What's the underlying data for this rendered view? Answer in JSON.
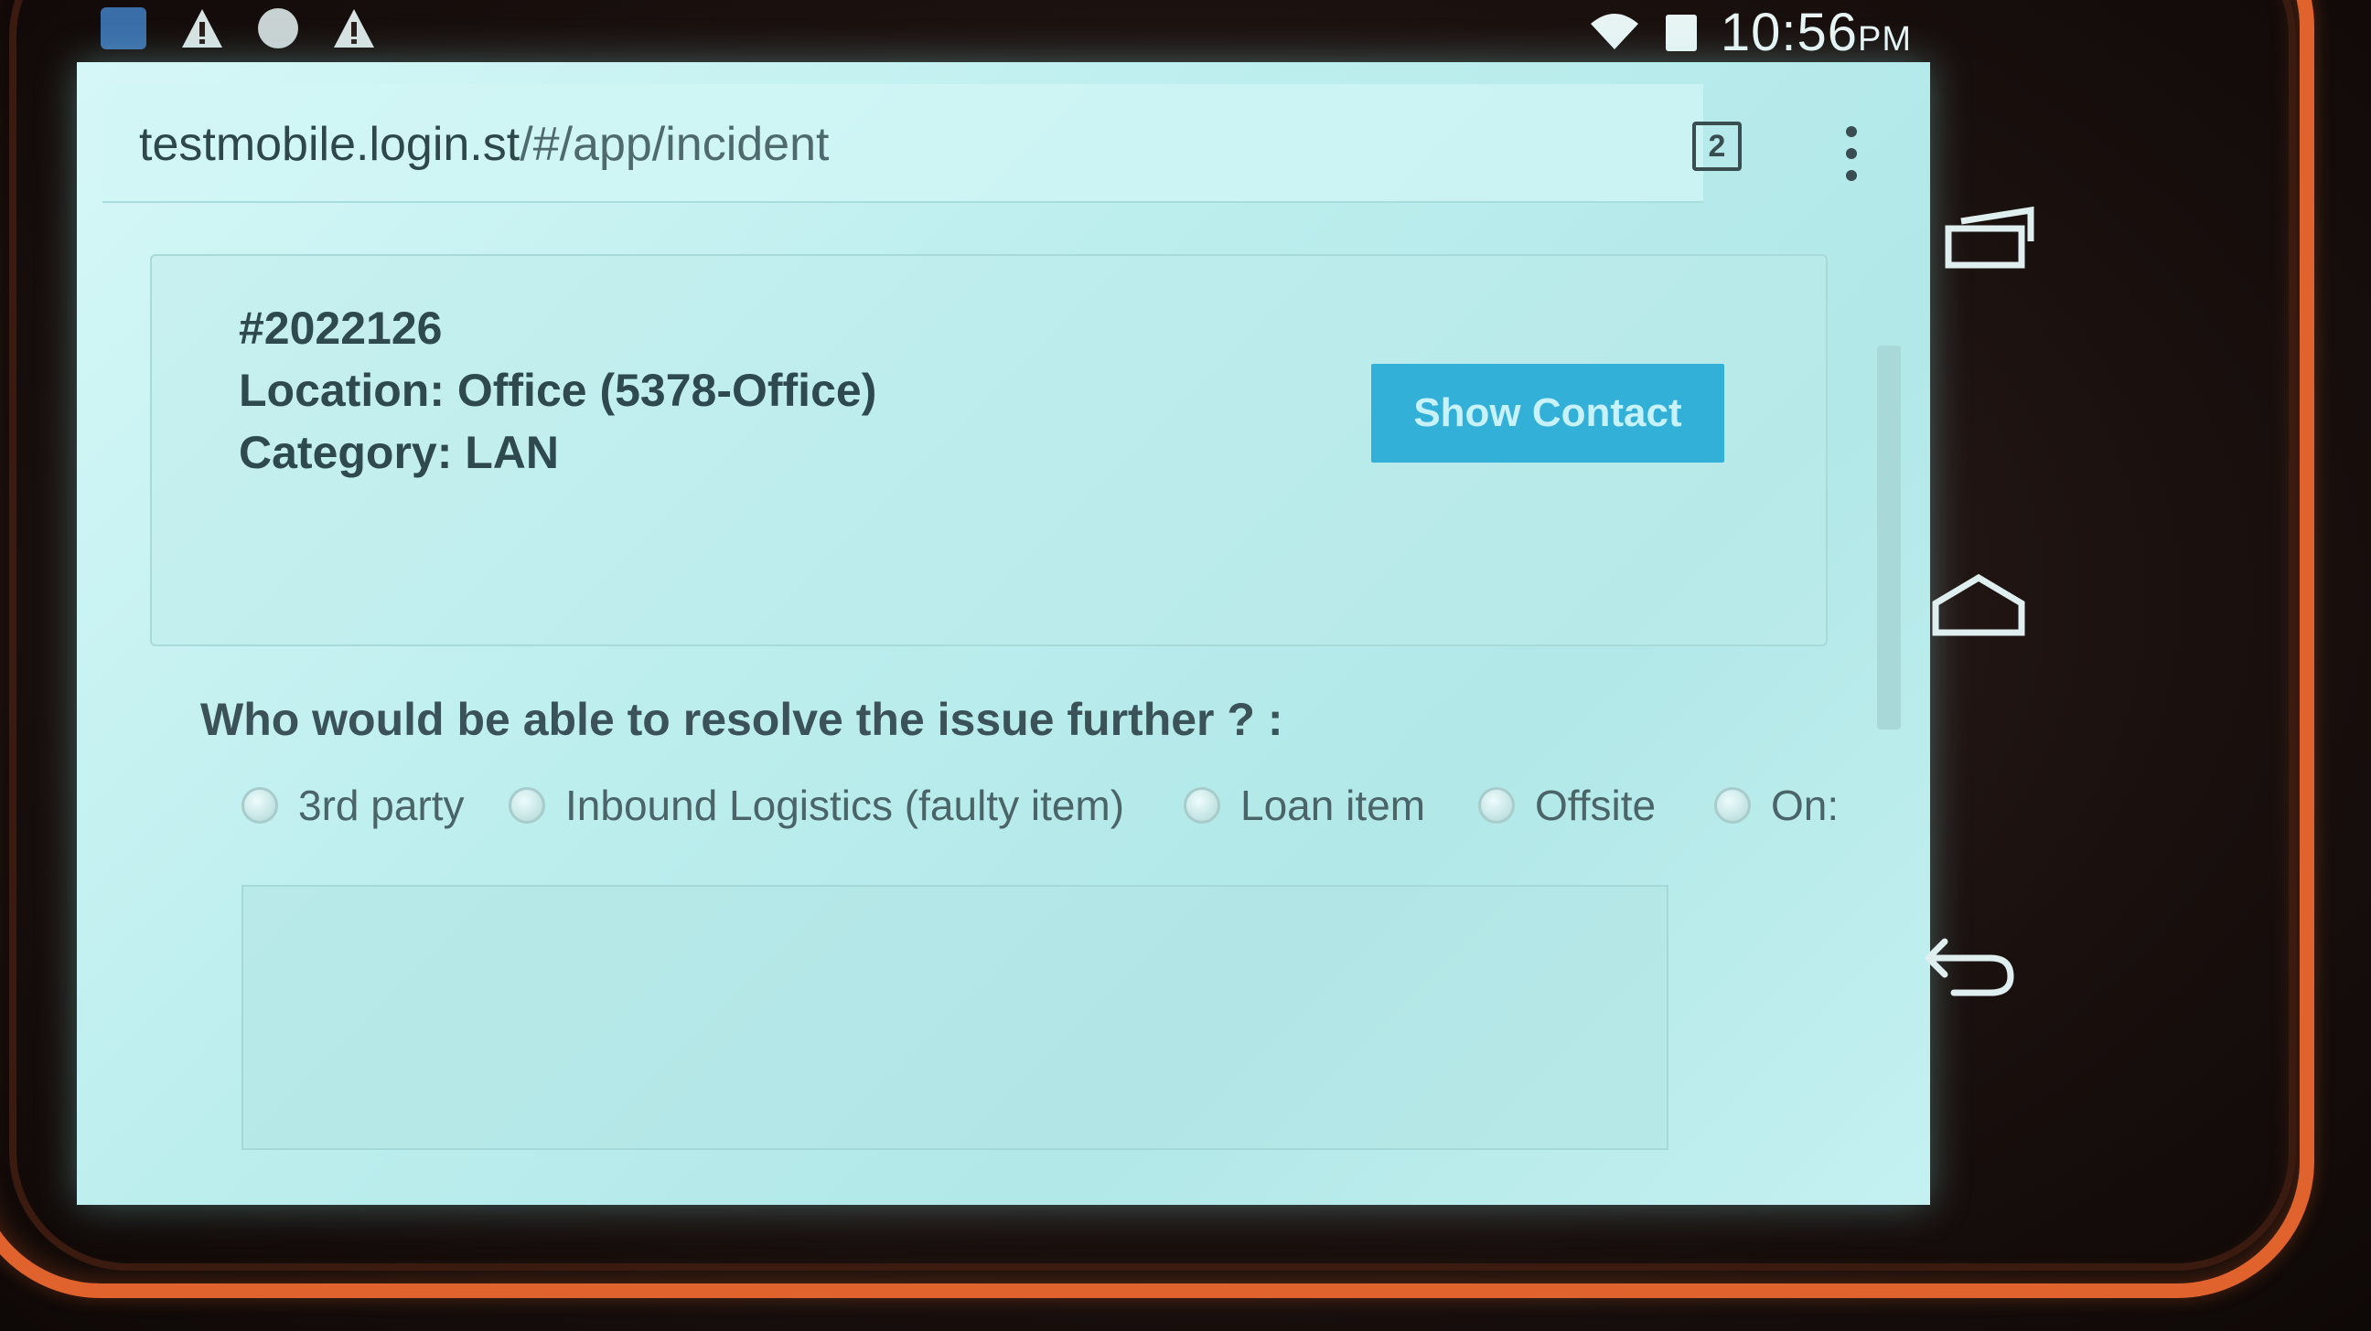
{
  "status_bar": {
    "time": "10:56",
    "ampm": "PM"
  },
  "browser": {
    "url_host": "testmobile.login.st",
    "url_path": "/#/app/incident",
    "tab_count": "2"
  },
  "incident": {
    "number": "#2022126",
    "location": "Location: Office (5378-Office)",
    "category": "Category: LAN",
    "show_contact_label": "Show Contact"
  },
  "resolution": {
    "question": "Who would be able to resolve the issue further ? :",
    "options": [
      {
        "label": "3rd party"
      },
      {
        "label": "Inbound Logistics (faulty item)"
      },
      {
        "label": "Loan item"
      },
      {
        "label": "Offsite"
      },
      {
        "label": "On:"
      }
    ]
  },
  "colors": {
    "screen": "#c4f0f0",
    "button": "#33b0d8",
    "bezel": "#e0622c"
  },
  "icons": {
    "status_left": [
      "notification-icon",
      "warning-icon",
      "sync-icon",
      "warning-icon"
    ],
    "status_right": [
      "wifi-icon",
      "battery-icon"
    ],
    "nav": [
      "recent-apps-icon",
      "home-icon",
      "back-icon"
    ]
  }
}
